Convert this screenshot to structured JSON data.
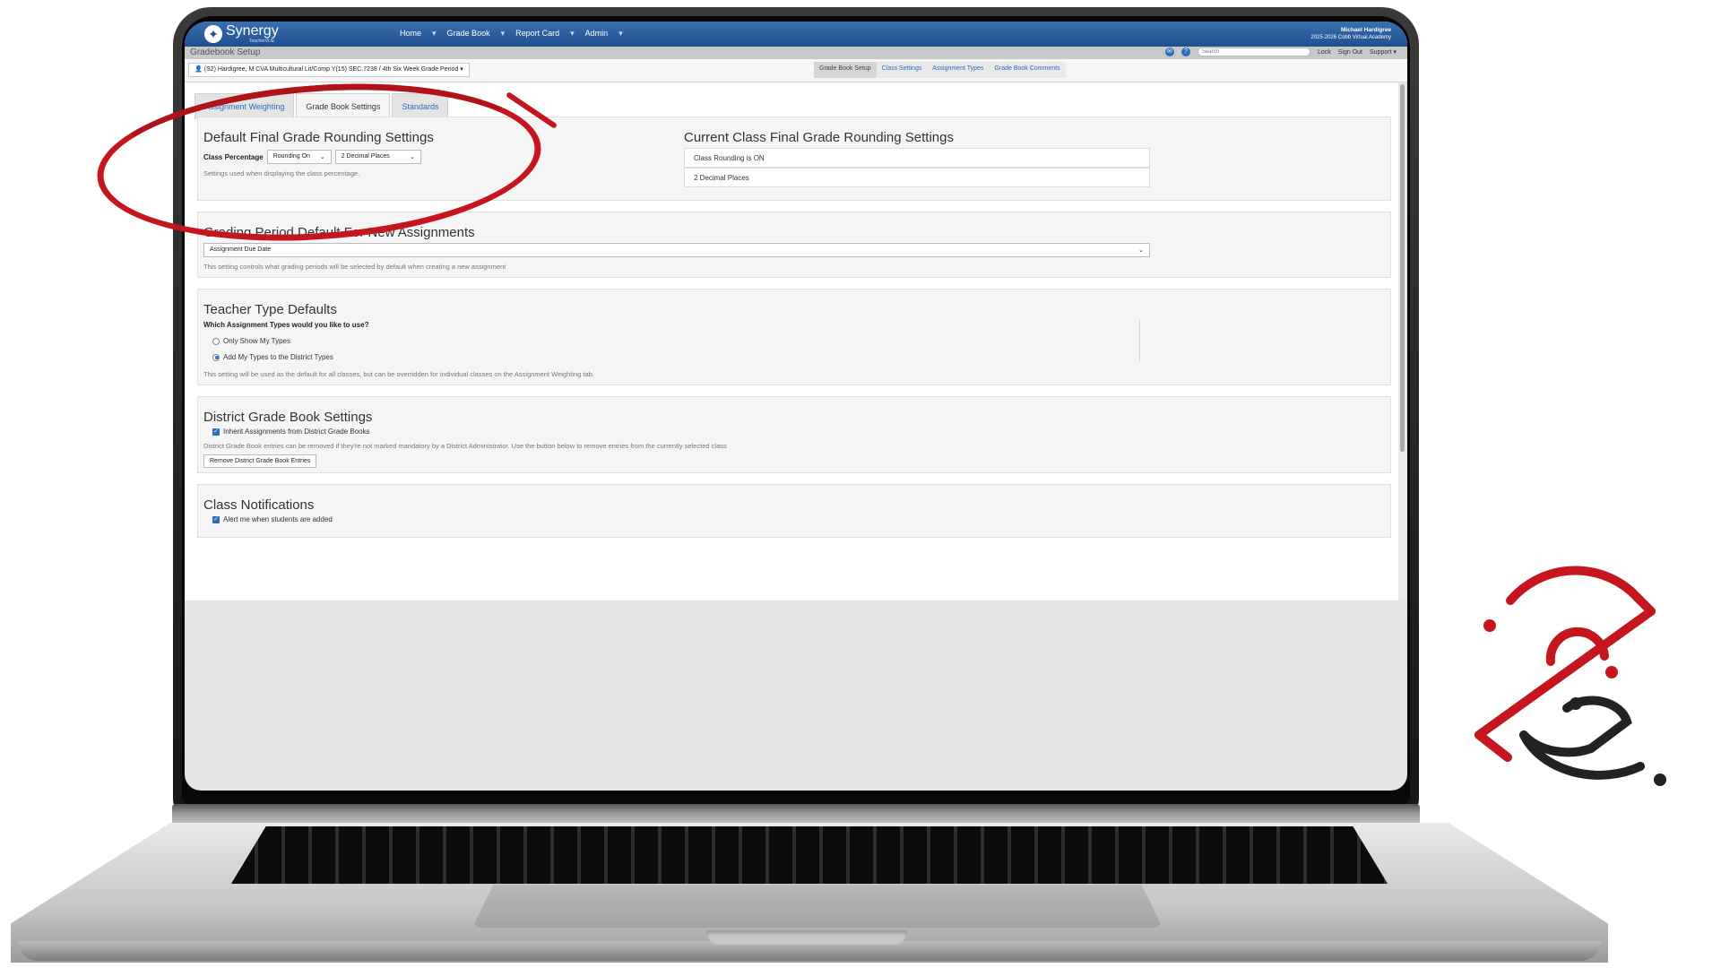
{
  "app": {
    "brand": "Synergy",
    "brand_sub": "TeacherVUE",
    "nav": [
      "Home",
      "Grade Book",
      "Report Card",
      "Admin"
    ],
    "user_name": "Michael Hardigree",
    "user_school": "2025-2026 Cobb Virtual Academy",
    "page_title": "Gradebook Setup",
    "search_placeholder": "Search",
    "util_links": [
      "Lock",
      "Sign Out",
      "Support ▾"
    ]
  },
  "class_selector": "(S2) Hardigree, M CVA Multicultural Lit/Comp Y(15) SEC.7238 / 4th Six Week Grade Period ▾",
  "class_tabs": [
    "Grade Book Setup",
    "Class Settings",
    "Assignment Types",
    "Grade Book Comments"
  ],
  "tabs": [
    "Assignment Weighting",
    "Grade Book Settings",
    "Standards"
  ],
  "rounding": {
    "title": "Default Final Grade Rounding Settings",
    "label": "Class Percentage",
    "rounding_value": "Rounding On",
    "decimal_value": "2 Decimal Places",
    "help": "Settings used when displaying the class percentage.",
    "current_title": "Current Class Final Grade Rounding Settings",
    "current_rows": [
      "Class Rounding is ON",
      "2 Decimal Places"
    ]
  },
  "grading_period": {
    "title": "Grading Period Default For New Assignments",
    "value": "Assignment Due Date",
    "help": "This setting controls what grading periods will be selected by default when creating a new assignment"
  },
  "teacher_type": {
    "title": "Teacher Type Defaults",
    "question": "Which Assignment Types would you like to use?",
    "options": [
      "Only Show My Types",
      "Add My Types to the District Types"
    ],
    "selected": "Add My Types to the District Types",
    "help": "This setting will be used as the default for all classes, but can be overridden for individual classes on the Assignment Weighting tab."
  },
  "district": {
    "title": "District Grade Book Settings",
    "checkbox": "Inherit Assignments from District Grade Books",
    "help": "District Grade Book entries can be removed if they're not marked mandatory by a District Administrator. Use the button below to remove entries from the currently selected class",
    "button": "Remove District Grade Book Entries"
  },
  "notifications": {
    "title": "Class Notifications",
    "checkbox": "Alert me when students are added"
  },
  "colors": {
    "header_blue": "#2a5d9f",
    "link_blue": "#2a6ebd",
    "annotation_red": "#c4161c",
    "logo_dark": "#222222"
  }
}
